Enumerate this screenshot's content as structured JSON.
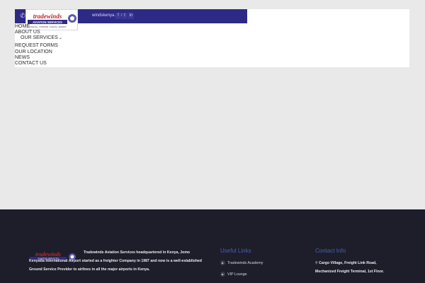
{
  "header": {
    "email_fragment": "windskenya.com",
    "social_icons": [
      "facebook-icon",
      "twitter-icon",
      "linkedin-icon"
    ],
    "logo": {
      "brand": "tradewinds",
      "subtitle": "AVIATION SERVICES",
      "tagline": "HANDLING • CHARTERS • FUELING • PERMITS"
    },
    "colors": {
      "topbar": "#2d2a86",
      "footer_bg": "#1d1e2a",
      "footer_heading": "#4b5fb3"
    }
  },
  "nav": {
    "items": [
      {
        "label": "HOME"
      },
      {
        "label": "ABOUT US"
      },
      {
        "label": "OUR SERVICES"
      },
      {
        "label": "REQUEST FORMS"
      },
      {
        "label": "OUR LOCATION"
      },
      {
        "label": "NEWS"
      },
      {
        "label": "CONTACT US"
      }
    ]
  },
  "footer": {
    "about": "Tradewinds Aviation Services headquartered in Kenya, Jomo Kenyatta International Airport started as a freighter Company in 1987 and now is a well-established Ground Service Provider to airlines in all the major airports in Kenya.",
    "useful_links": {
      "title": "Useful Links",
      "items": [
        "Tradewinds Academy",
        "VIP Lounge"
      ]
    },
    "contact": {
      "title": "Contact Info",
      "address": "Cargo Village, Freight Link Road, Mechanized Freight Terminal, 1st Floor."
    }
  }
}
